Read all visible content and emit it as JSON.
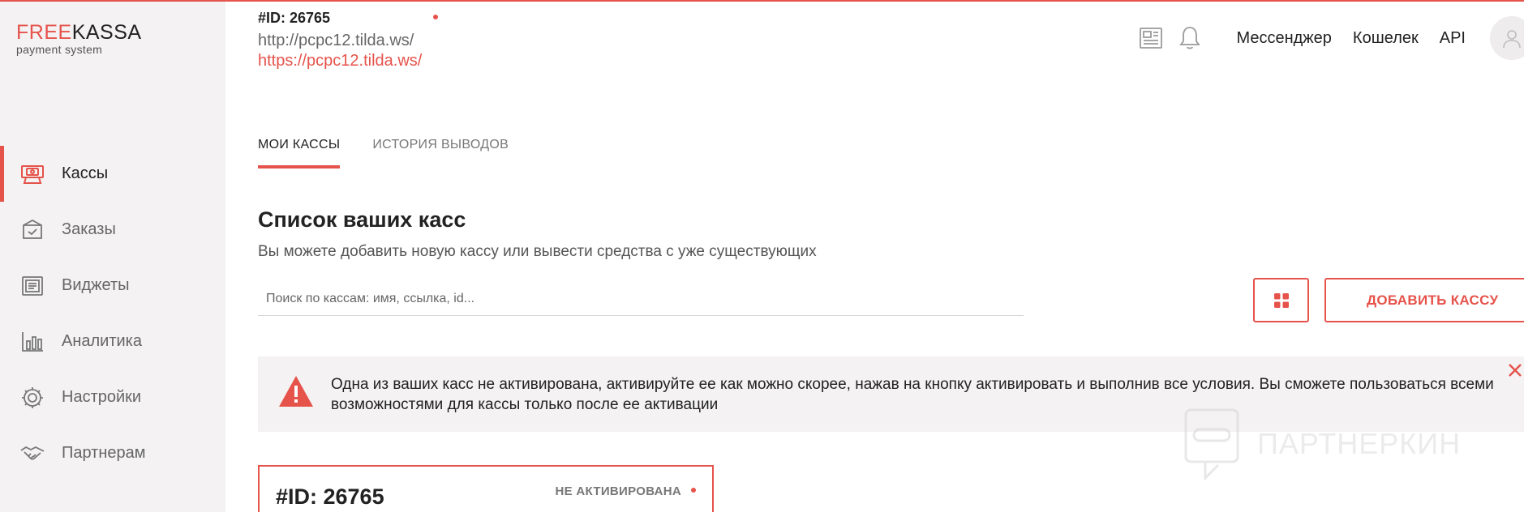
{
  "brand": {
    "logo_accent": "FREE",
    "logo_rest": "KASSA",
    "tagline": "payment system",
    "accent_color": "#e5534b"
  },
  "sidebar": {
    "items": [
      {
        "label": "Кассы",
        "icon": "cash-register-icon",
        "active": true
      },
      {
        "label": "Заказы",
        "icon": "order-box-icon",
        "active": false
      },
      {
        "label": "Виджеты",
        "icon": "widget-icon",
        "active": false
      },
      {
        "label": "Аналитика",
        "icon": "analytics-chart-icon",
        "active": false
      },
      {
        "label": "Настройки",
        "icon": "gear-icon",
        "active": false
      },
      {
        "label": "Партнерам",
        "icon": "handshake-icon",
        "active": false
      }
    ]
  },
  "site": {
    "id": "#ID: 26765",
    "url_primary": "http://pcpc12.tilda.ws/",
    "url_secondary": "https://pcpc12.tilda.ws/"
  },
  "header": {
    "icons": [
      "news-icon",
      "bell-icon"
    ],
    "links": [
      "Мессенджер",
      "Кошелек",
      "API"
    ],
    "avatar_icon": "user-avatar-icon"
  },
  "tabs": [
    {
      "label": "МОИ КАССЫ",
      "active": true
    },
    {
      "label": "ИСТОРИЯ ВЫВОДОВ",
      "active": false
    }
  ],
  "main": {
    "title": "Список ваших касс",
    "subtitle": "Вы можете добавить новую кассу или вывести средства с уже существующих",
    "search_placeholder": "Поиск по кассам: имя, ссылка, id...",
    "add_button": "ДОБАВИТЬ КАССУ"
  },
  "alert": {
    "text": "Одна из ваших касс не активирована, активируйте ее как можно скорее, нажав на кнопку активировать и выполнив все условия. Вы сможете пользоваться всеми возможностями для кассы только после ее активации"
  },
  "watermark": {
    "text": "ПАРТНЕРКИН"
  },
  "card": {
    "id": "#ID: 26765",
    "status": "НЕ АКТИВИРОВАНА"
  }
}
